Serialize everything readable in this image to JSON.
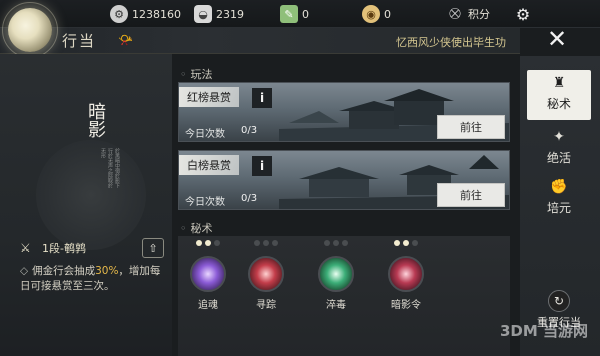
{
  "currencies": [
    {
      "name": "gear",
      "value": "1238160"
    },
    {
      "name": "ingot",
      "value": "2319"
    },
    {
      "name": "leaf",
      "value": "0"
    },
    {
      "name": "purse",
      "value": "0"
    },
    {
      "name": "points",
      "label": "积分"
    }
  ],
  "header": {
    "title": "行当",
    "notice": "忆西风少侠使出毕生功"
  },
  "emblem": {
    "title": "暗影",
    "text": "於黑暗中宿於影下行於无声之际取於无形"
  },
  "rank": {
    "label": "1段-鹌鹑",
    "up_icon": "⇧"
  },
  "description": {
    "prefix": "佣金行会抽成",
    "highlight": "30%",
    "suffix": "，增加每日可接悬赏至三次。"
  },
  "sections": {
    "play": "玩法",
    "secret": "秘术"
  },
  "bounties": [
    {
      "name": "红榜悬赏",
      "count_label": "今日次数",
      "count": "0/3",
      "button": "前往"
    },
    {
      "name": "白榜悬赏",
      "count_label": "今日次数",
      "count": "0/3",
      "button": "前往"
    }
  ],
  "skills": [
    {
      "name": "追魂",
      "pips": [
        1,
        1,
        0
      ],
      "color": "#8b5bd6"
    },
    {
      "name": "寻踪",
      "pips": [
        0,
        0,
        0
      ],
      "color": "#c33d4a"
    },
    {
      "name": "淬毒",
      "pips": [
        0,
        0,
        0
      ],
      "color": "#3cae78"
    },
    {
      "name": "暗影令",
      "pips": [
        1,
        1,
        0
      ],
      "color": "#b83a53"
    }
  ],
  "tabs": [
    {
      "label": "秘术",
      "icon": "dagger-icon",
      "active": true
    },
    {
      "label": "绝活",
      "icon": "sparkle-icon",
      "active": false
    },
    {
      "label": "培元",
      "icon": "fist-icon",
      "active": false
    }
  ],
  "reset": {
    "label": "重置行当"
  },
  "watermark": "3DM 当游网"
}
